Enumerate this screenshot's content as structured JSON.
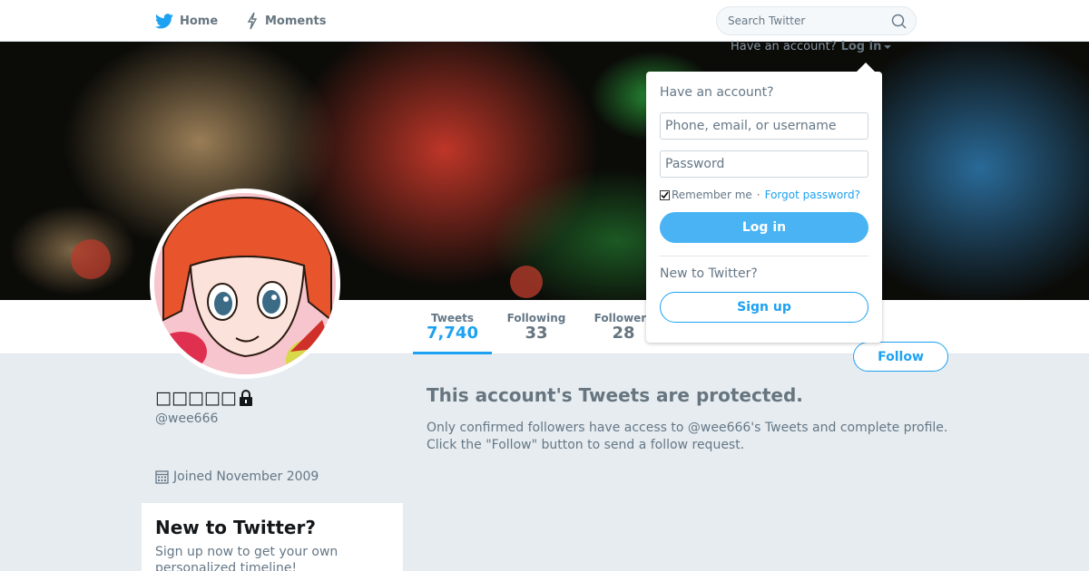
{
  "nav": {
    "home_label": "Home",
    "moments_label": "Moments",
    "search_placeholder": "Search Twitter"
  },
  "login_menu": {
    "prompt": "Have an account?",
    "login_label": "Log in"
  },
  "login_dropdown": {
    "heading": "Have an account?",
    "username_placeholder": "Phone, email, or username",
    "password_placeholder": "Password",
    "remember_label": "Remember me",
    "separator": "·",
    "forgot_label": "Forgot password?",
    "login_button": "Log in",
    "new_heading": "New to Twitter?",
    "signup_button": "Sign up"
  },
  "profile": {
    "display_name": "□□□□□",
    "handle": "@wee666",
    "joined": "Joined November 2009",
    "follow_button": "Follow"
  },
  "stats": [
    {
      "label": "Tweets",
      "value": "7,740"
    },
    {
      "label": "Following",
      "value": "33"
    },
    {
      "label": "Followers",
      "value": "28"
    }
  ],
  "protected": {
    "title": "This account's Tweets are protected.",
    "text": "Only confirmed followers have access to @wee666's Tweets and complete profile. Click the \"Follow\" button to send a follow request."
  },
  "signup_card": {
    "title": "New to Twitter?",
    "text": "Sign up now to get your own personalized timeline!"
  },
  "colors": {
    "accent": "#1da1f2",
    "background": "#e6ecf0"
  }
}
